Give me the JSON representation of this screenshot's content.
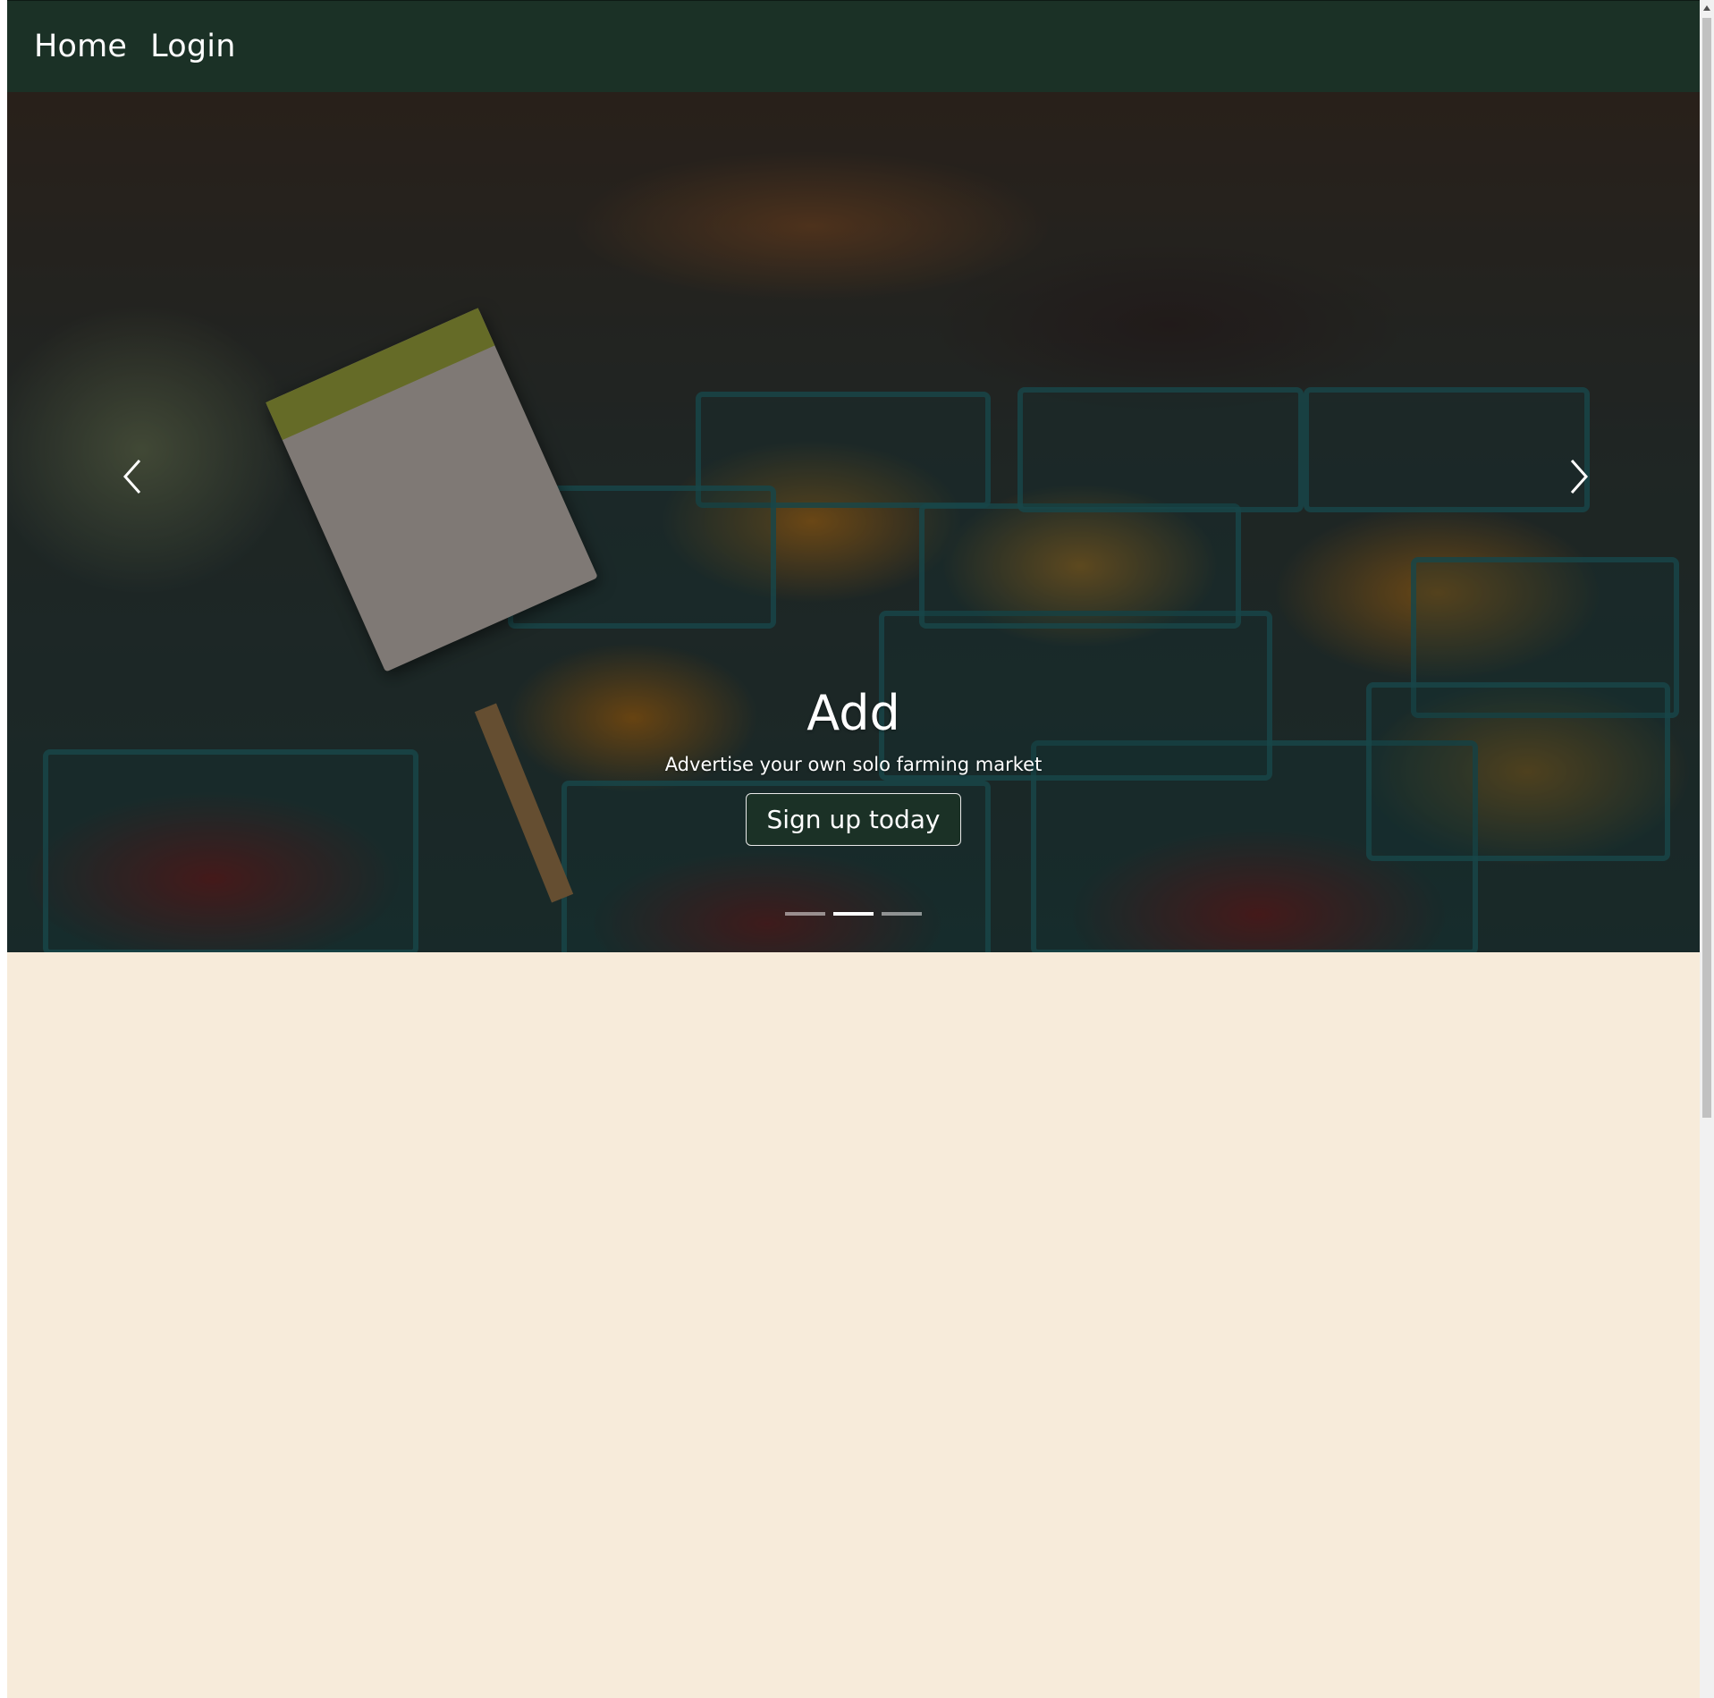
{
  "navbar": {
    "links": [
      {
        "label": "Home"
      },
      {
        "label": "Login"
      }
    ],
    "background": "#1b3126"
  },
  "hero": {
    "slide": {
      "title": "Add",
      "text": "Advertise your own solo farming market",
      "button_label": "Sign up today"
    },
    "controls": {
      "prev_icon": "chevron-left-icon",
      "next_icon": "chevron-right-icon"
    },
    "indicators": {
      "count": 3,
      "active_index": 1
    }
  },
  "page": {
    "background": "#f7ebda"
  }
}
